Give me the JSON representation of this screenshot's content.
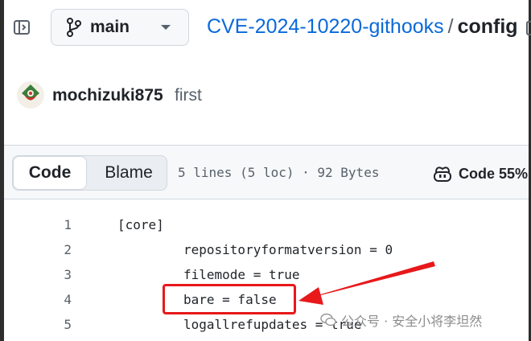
{
  "header": {
    "branch": "main",
    "repo": "CVE-2024-10220-githooks",
    "separator": "/",
    "file": "config"
  },
  "commit": {
    "author": "mochizuki875",
    "message": "first"
  },
  "file_header": {
    "tabs": [
      {
        "label": "Code",
        "selected": true
      },
      {
        "label": "Blame",
        "selected": false
      }
    ],
    "meta": "5 lines (5 loc) · 92 Bytes",
    "copilot_label": "Code 55%"
  },
  "code": [
    {
      "num": "1",
      "text": "[core]"
    },
    {
      "num": "2",
      "text": "repositoryformatversion = 0"
    },
    {
      "num": "3",
      "text": "filemode = true"
    },
    {
      "num": "4",
      "text": "bare = false"
    },
    {
      "num": "5",
      "text": "logallrefupdates = true"
    }
  ],
  "watermark": "公众号 · 安全小将李坦然",
  "colors": {
    "link": "#0969da",
    "annotation": "#e8181b",
    "muted": "#57606a"
  }
}
